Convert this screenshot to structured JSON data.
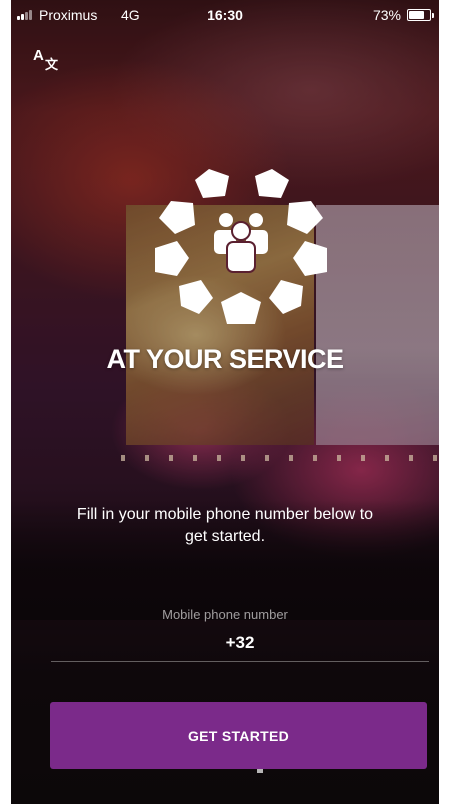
{
  "status_bar": {
    "carrier": "Proximus",
    "network": "4G",
    "time": "16:30",
    "battery_percent": "73%",
    "battery_level": 0.73
  },
  "toolbar": {
    "translate_icon_latin": "A",
    "translate_icon_glyph": "文"
  },
  "hero": {
    "tagline": "AT YOUR SERVICE"
  },
  "onboarding": {
    "intro_text": "Fill in your mobile phone number below to get started.",
    "phone_label": "Mobile phone number",
    "phone_value": "+32",
    "cta_label": "GET STARTED"
  },
  "colors": {
    "cta_background": "#7b2a8a",
    "text": "#ffffff"
  },
  "icons": {
    "translate": "translate-icon",
    "logo": "people-group-logo-icon"
  }
}
